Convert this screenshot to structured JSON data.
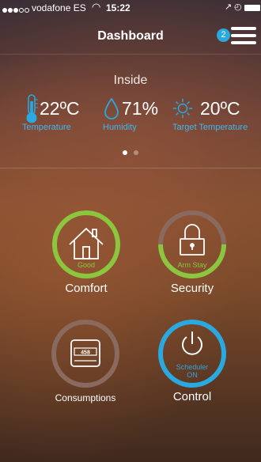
{
  "status_bar": {
    "carrier": "vodafone ES",
    "time": "15:22"
  },
  "nav": {
    "title": "Dashboard",
    "badge_count": "2"
  },
  "inside": {
    "heading": "Inside",
    "temperature": {
      "value": "22ºC",
      "label": "Temperature"
    },
    "humidity": {
      "value": "71%",
      "label": "Humidity"
    },
    "target": {
      "value": "20ºC",
      "label": "Target Temperature"
    }
  },
  "tiles": {
    "comfort": {
      "status": "Good",
      "label": "Comfort"
    },
    "security": {
      "status": "Arm Stay",
      "label": "Security"
    },
    "consumptions": {
      "display": "458",
      "label": "Consumptions"
    },
    "control": {
      "status_line1": "Scheduler",
      "status_line2": "ON",
      "label": "Control"
    }
  },
  "colors": {
    "accent_blue": "#2aa8e0",
    "good_green": "#8cc63f",
    "ring_brown": "#8a6a5e"
  },
  "icons": [
    "wifi-icon",
    "location-arrow-icon",
    "alarm-clock-icon",
    "battery-icon",
    "menu-icon",
    "thermometer-icon",
    "water-drop-icon",
    "sun-icon",
    "house-icon",
    "padlock-icon",
    "meter-icon",
    "power-icon"
  ]
}
